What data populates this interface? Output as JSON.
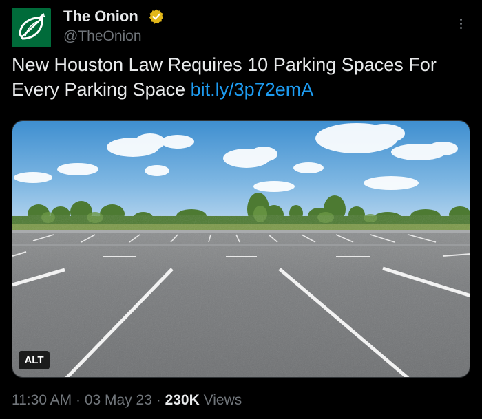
{
  "author": {
    "name": "The Onion",
    "handle": "@TheOnion",
    "verified": true
  },
  "tweet": {
    "text": "New Houston Law Requires 10 Parking Spaces For Every Parking Space",
    "link": "bit.ly/3p72emA"
  },
  "media": {
    "alt_label": "ALT"
  },
  "meta": {
    "time": "11:30 AM",
    "separator": " · ",
    "date": "03 May 23",
    "views_count": "230K",
    "views_label": " Views"
  },
  "icons": {
    "avatar": "onion-logo-icon",
    "verified": "verified-badge-icon",
    "more": "more-options-icon"
  },
  "colors": {
    "background": "#000000",
    "text": "#e7e9ea",
    "secondary": "#71767b",
    "link": "#1d9bf0",
    "verified_badge": "#e2b719",
    "avatar_bg": "#006b3a"
  }
}
